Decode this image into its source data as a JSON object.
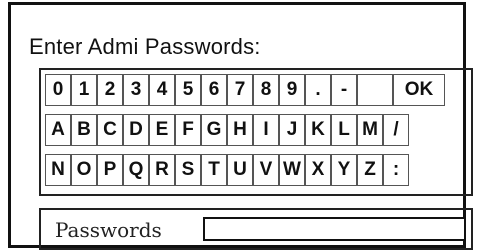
{
  "title": "Enter Admi Passwords:",
  "keys": {
    "row1": [
      "0",
      "1",
      "2",
      "3",
      "4",
      "5",
      "6",
      "7",
      "8",
      "9",
      ".",
      "-",
      "OK"
    ],
    "row2": [
      "A",
      "B",
      "C",
      "D",
      "E",
      "F",
      "G",
      "H",
      "I",
      "J",
      "K",
      "L",
      "M",
      "/"
    ],
    "row3": [
      "N",
      "O",
      "P",
      "Q",
      "R",
      "S",
      "T",
      "U",
      "V",
      "W",
      "X",
      "Y",
      "Z",
      ":"
    ]
  },
  "password": {
    "label": "Passwords",
    "value": ""
  }
}
